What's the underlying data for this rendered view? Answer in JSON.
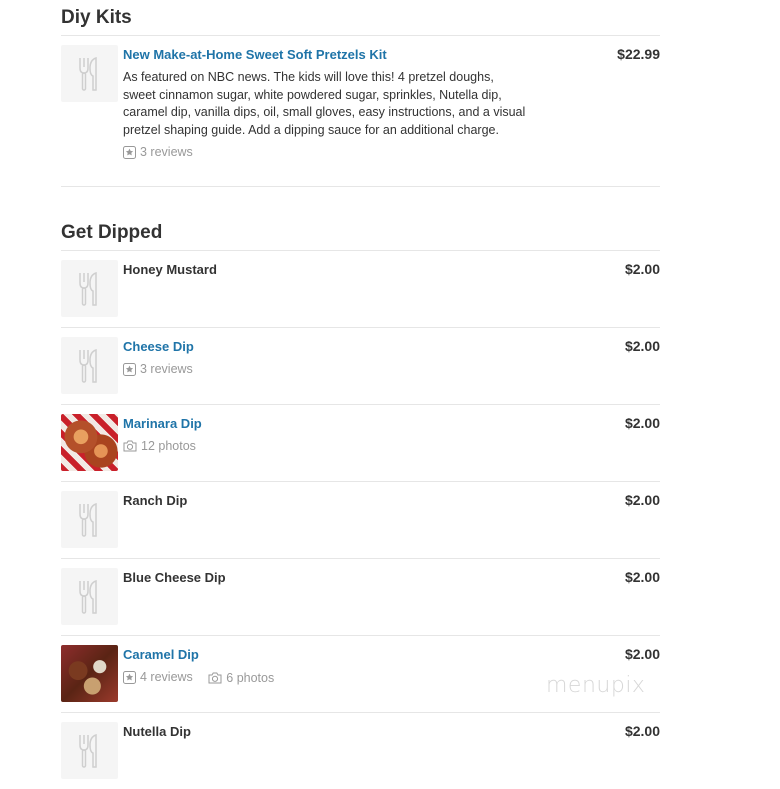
{
  "sections": [
    {
      "title": "Diy Kits",
      "items": [
        {
          "name": "New Make-at-Home Sweet Soft Pretzels Kit",
          "description": "As featured on NBC news. The kids will love this! 4 pretzel doughs, sweet cinnamon sugar, white powdered sugar, sprinkles, Nutella dip, caramel dip, vanilla dips, oil, small gloves, easy instructions, and a visual pretzel shaping guide. Add a dipping sauce for an additional charge.",
          "reviews": "3 reviews",
          "price": "$22.99"
        }
      ]
    },
    {
      "title": "Get Dipped",
      "items": [
        {
          "name": "Honey Mustard",
          "price": "$2.00"
        },
        {
          "name": "Cheese Dip",
          "reviews": "3 reviews",
          "price": "$2.00"
        },
        {
          "name": "Marinara Dip",
          "photos": "12 photos",
          "price": "$2.00"
        },
        {
          "name": "Ranch Dip",
          "price": "$2.00"
        },
        {
          "name": "Blue Cheese Dip",
          "price": "$2.00"
        },
        {
          "name": "Caramel Dip",
          "reviews": "4 reviews",
          "photos": "6 photos",
          "price": "$2.00"
        },
        {
          "name": "Nutella Dip",
          "price": "$2.00"
        }
      ]
    }
  ],
  "watermark": "menupix",
  "colors": {
    "link": "#1f74a8",
    "text": "#333333",
    "muted": "#999999",
    "divider": "#e6e6e6"
  },
  "icons": {
    "placeholder": "fork-knife-icon",
    "reviews": "star-box-icon",
    "photos": "camera-icon"
  }
}
